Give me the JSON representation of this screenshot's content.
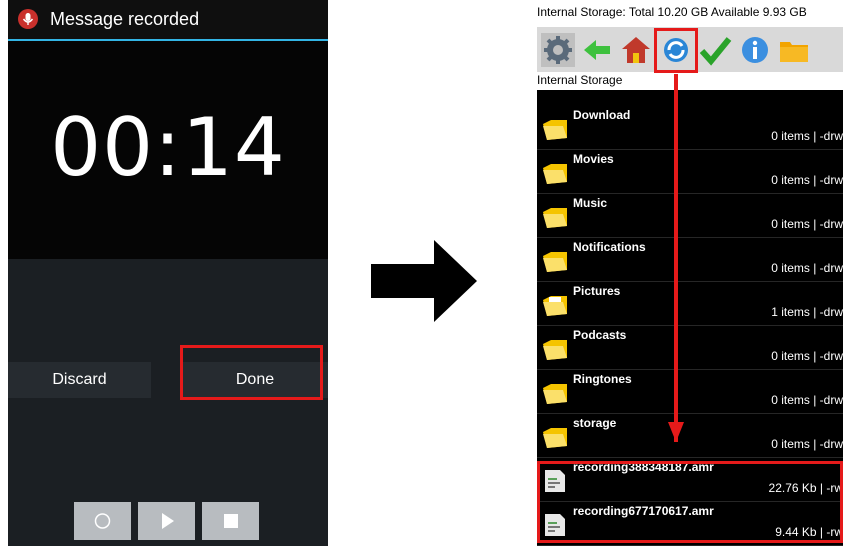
{
  "left_screen": {
    "title": "Message recorded",
    "timer": "00:14",
    "discard_label": "Discard",
    "done_label": "Done",
    "controls": [
      "record-icon",
      "play-icon",
      "stop-icon"
    ],
    "accent_color": "#33b5e5",
    "highlight_color": "#e51a1a"
  },
  "right_screen": {
    "status": "Internal Storage:  Total 10.20 GB  Available 9.93 GB",
    "toolbar_icons": [
      "gear-icon",
      "back-arrow-icon",
      "home-icon",
      "refresh-icon",
      "checkmark-icon",
      "info-icon",
      "folder-icon"
    ],
    "path": "Internal Storage",
    "rows": [
      {
        "name": "Download",
        "info": "0 items | -drw"
      },
      {
        "name": "Movies",
        "info": "0 items | -drw"
      },
      {
        "name": "Music",
        "info": "0 items | -drw"
      },
      {
        "name": "Notifications",
        "info": "0 items | -drw"
      },
      {
        "name": "Pictures",
        "info": "1 items | -drw"
      },
      {
        "name": "Podcasts",
        "info": "0 items | -drw"
      },
      {
        "name": "Ringtones",
        "info": "0 items | -drw"
      },
      {
        "name": "storage",
        "info": "0 items | -drw"
      },
      {
        "name": "recording388348187.amr",
        "info": "22.76 Kb  | -rw"
      },
      {
        "name": "recording677170617.amr",
        "info": "9.44 Kb  | -rw"
      }
    ]
  }
}
